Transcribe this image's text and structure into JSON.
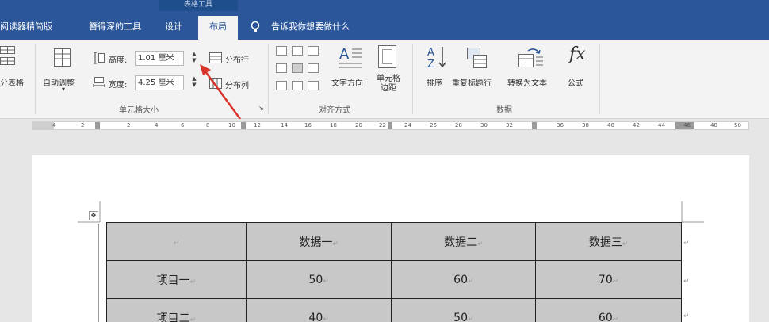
{
  "contextual_tab_group": "表格工具",
  "tabs": [
    {
      "label": "阅读器精简版"
    },
    {
      "label": "簪得深的工具"
    },
    {
      "label": "设计"
    },
    {
      "label": "布局"
    }
  ],
  "tell_me": "告诉我你想要做什么",
  "ribbon": {
    "split_table": "分表格",
    "autofit": "自动调整",
    "height_label": "高度:",
    "height_value": "1.01 厘米",
    "width_label": "宽度:",
    "width_value": "4.25 厘米",
    "distribute_rows": "分布行",
    "distribute_cols": "分布列",
    "group_cell_size": "单元格大小",
    "text_direction": "文字方向",
    "cell_margins": "单元格边距",
    "group_alignment": "对齐方式",
    "sort": "排序",
    "repeat_header": "重复标题行",
    "convert_text": "转换为文本",
    "formula": "公式",
    "formula_glyph": "fx",
    "group_data": "数据"
  },
  "ruler": [
    "4",
    "2",
    "2",
    "4",
    "6",
    "8",
    "10",
    "12",
    "14",
    "16",
    "18",
    "20",
    "22",
    "24",
    "26",
    "28",
    "30",
    "32",
    "36",
    "38",
    "40",
    "42",
    "44",
    "46",
    "48",
    "50"
  ],
  "table": {
    "rows": [
      [
        "",
        "数据一",
        "数据二",
        "数据三"
      ],
      [
        "项目一",
        "50",
        "60",
        "70"
      ],
      [
        "项目二",
        "40",
        "50",
        "60"
      ]
    ]
  },
  "colors": {
    "accent": "#2b579a",
    "annotation_arrow": "#d9342b"
  }
}
